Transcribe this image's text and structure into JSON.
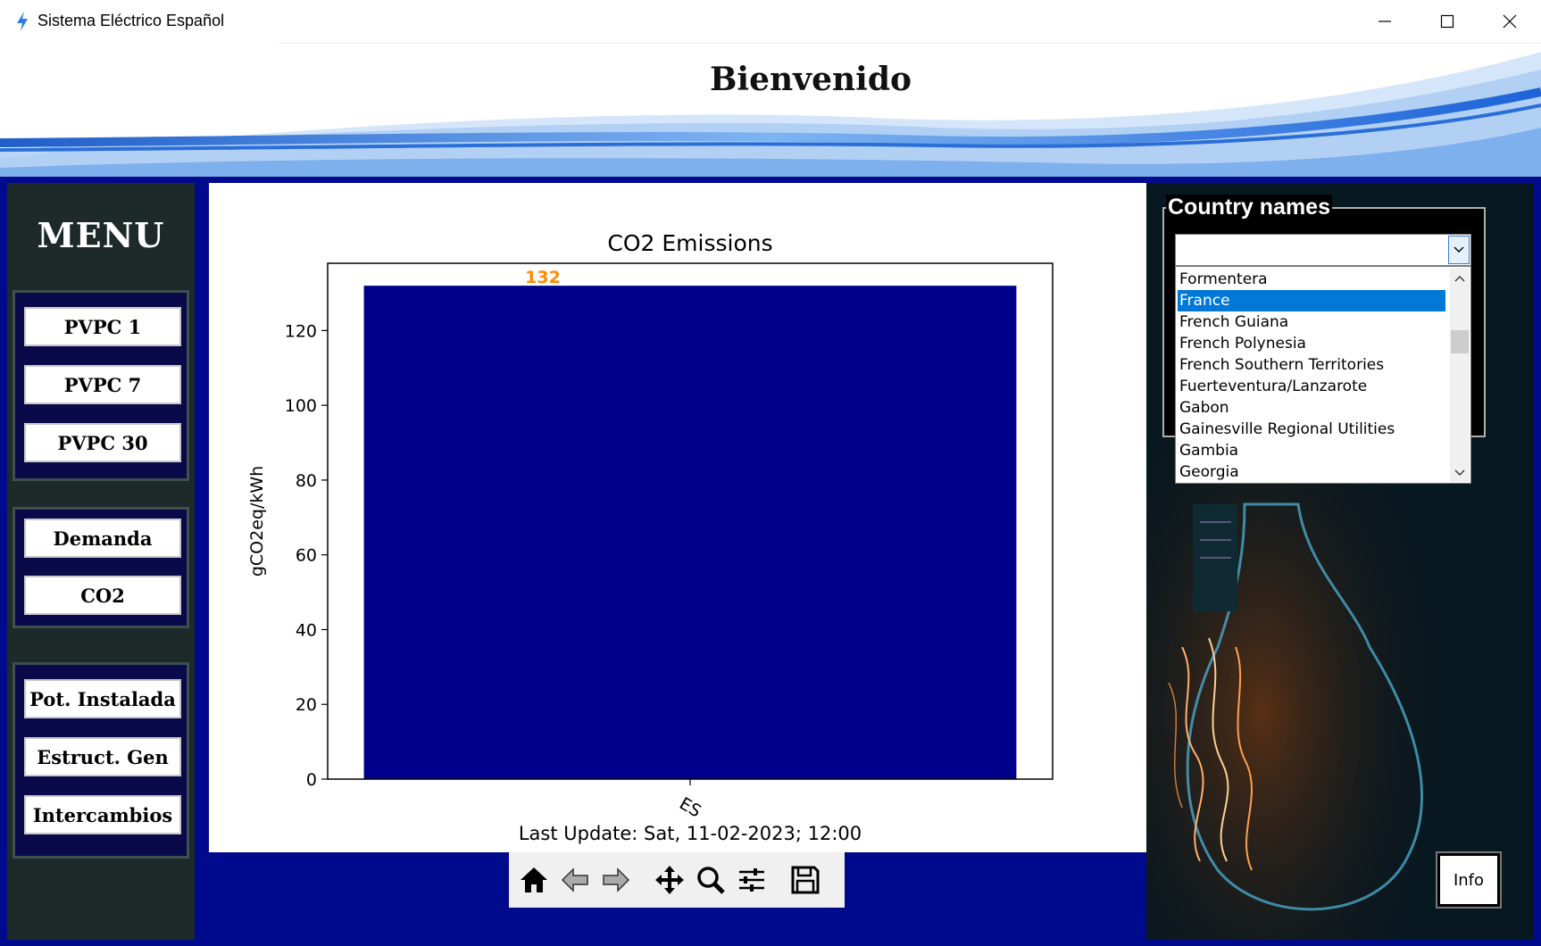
{
  "window": {
    "title": "Sistema Eléctrico Español",
    "controls": [
      "minimize-icon",
      "maximize-icon",
      "close-icon"
    ]
  },
  "banner": {
    "heading": "Bienvenido"
  },
  "sidebar": {
    "title": "MENU",
    "groups": [
      [
        "PVPC 1",
        "PVPC 7",
        "PVPC 30"
      ],
      [
        "Demanda",
        "CO2"
      ],
      [
        "Pot. Instalada",
        "Estruct. Gen",
        "Intercambios"
      ]
    ]
  },
  "chart_data": {
    "type": "bar",
    "title": "CO2 Emissions",
    "categories": [
      "ES"
    ],
    "values": [
      132
    ],
    "data_labels": [
      "132"
    ],
    "xlabel": "",
    "ylabel": "gCO2eq/kWh",
    "ylim": [
      0,
      138
    ],
    "yticks": [
      "0",
      "20",
      "40",
      "60",
      "80",
      "100",
      "120"
    ],
    "bar_color": "#00008b",
    "label_color": "#ff8c00",
    "grid": false
  },
  "last_update": "Last Update: Sat, 11-02-2023; 12:00",
  "toolbar": {
    "buttons": [
      "home-icon",
      "back-arrow-icon",
      "forward-arrow-icon",
      "pan-icon",
      "zoom-icon",
      "configure-subplots-icon",
      "save-icon"
    ]
  },
  "country_panel": {
    "label": "Country names",
    "combo_value": "",
    "items": [
      "Formentera",
      "France",
      "French Guiana",
      "French Polynesia",
      "French Southern Territories",
      "Fuerteventura/Lanzarote",
      "Gabon",
      "Gainesville Regional Utilities",
      "Gambia",
      "Georgia"
    ],
    "selected": "France"
  },
  "info_button": "Info"
}
